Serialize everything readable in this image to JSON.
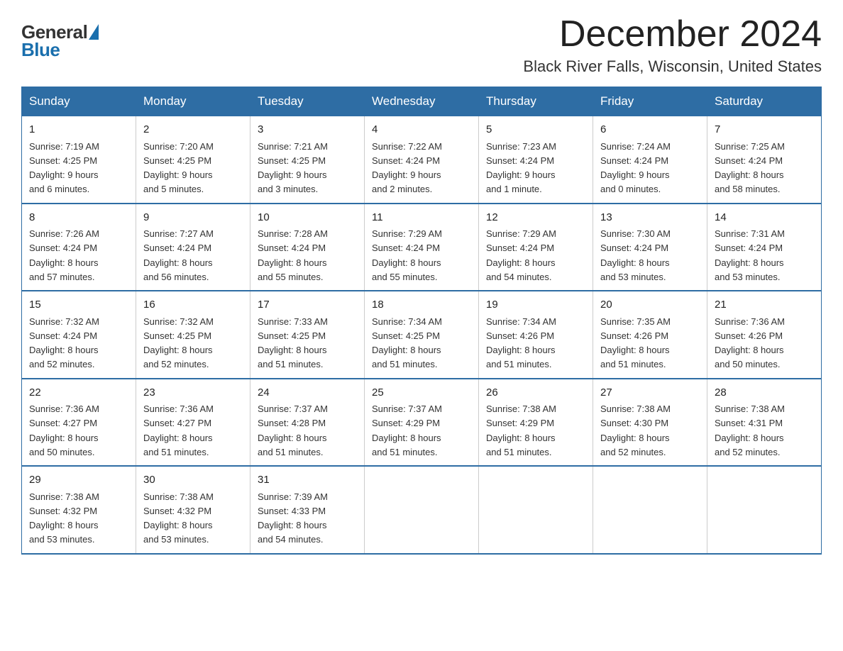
{
  "header": {
    "logo": {
      "general": "General",
      "blue": "Blue",
      "triangle": true
    },
    "title": "December 2024",
    "location": "Black River Falls, Wisconsin, United States"
  },
  "weekdays": [
    "Sunday",
    "Monday",
    "Tuesday",
    "Wednesday",
    "Thursday",
    "Friday",
    "Saturday"
  ],
  "weeks": [
    [
      {
        "day": "1",
        "sunrise": "7:19 AM",
        "sunset": "4:25 PM",
        "daylight": "9 hours and 6 minutes."
      },
      {
        "day": "2",
        "sunrise": "7:20 AM",
        "sunset": "4:25 PM",
        "daylight": "9 hours and 5 minutes."
      },
      {
        "day": "3",
        "sunrise": "7:21 AM",
        "sunset": "4:25 PM",
        "daylight": "9 hours and 3 minutes."
      },
      {
        "day": "4",
        "sunrise": "7:22 AM",
        "sunset": "4:24 PM",
        "daylight": "9 hours and 2 minutes."
      },
      {
        "day": "5",
        "sunrise": "7:23 AM",
        "sunset": "4:24 PM",
        "daylight": "9 hours and 1 minute."
      },
      {
        "day": "6",
        "sunrise": "7:24 AM",
        "sunset": "4:24 PM",
        "daylight": "9 hours and 0 minutes."
      },
      {
        "day": "7",
        "sunrise": "7:25 AM",
        "sunset": "4:24 PM",
        "daylight": "8 hours and 58 minutes."
      }
    ],
    [
      {
        "day": "8",
        "sunrise": "7:26 AM",
        "sunset": "4:24 PM",
        "daylight": "8 hours and 57 minutes."
      },
      {
        "day": "9",
        "sunrise": "7:27 AM",
        "sunset": "4:24 PM",
        "daylight": "8 hours and 56 minutes."
      },
      {
        "day": "10",
        "sunrise": "7:28 AM",
        "sunset": "4:24 PM",
        "daylight": "8 hours and 55 minutes."
      },
      {
        "day": "11",
        "sunrise": "7:29 AM",
        "sunset": "4:24 PM",
        "daylight": "8 hours and 55 minutes."
      },
      {
        "day": "12",
        "sunrise": "7:29 AM",
        "sunset": "4:24 PM",
        "daylight": "8 hours and 54 minutes."
      },
      {
        "day": "13",
        "sunrise": "7:30 AM",
        "sunset": "4:24 PM",
        "daylight": "8 hours and 53 minutes."
      },
      {
        "day": "14",
        "sunrise": "7:31 AM",
        "sunset": "4:24 PM",
        "daylight": "8 hours and 53 minutes."
      }
    ],
    [
      {
        "day": "15",
        "sunrise": "7:32 AM",
        "sunset": "4:24 PM",
        "daylight": "8 hours and 52 minutes."
      },
      {
        "day": "16",
        "sunrise": "7:32 AM",
        "sunset": "4:25 PM",
        "daylight": "8 hours and 52 minutes."
      },
      {
        "day": "17",
        "sunrise": "7:33 AM",
        "sunset": "4:25 PM",
        "daylight": "8 hours and 51 minutes."
      },
      {
        "day": "18",
        "sunrise": "7:34 AM",
        "sunset": "4:25 PM",
        "daylight": "8 hours and 51 minutes."
      },
      {
        "day": "19",
        "sunrise": "7:34 AM",
        "sunset": "4:26 PM",
        "daylight": "8 hours and 51 minutes."
      },
      {
        "day": "20",
        "sunrise": "7:35 AM",
        "sunset": "4:26 PM",
        "daylight": "8 hours and 51 minutes."
      },
      {
        "day": "21",
        "sunrise": "7:36 AM",
        "sunset": "4:26 PM",
        "daylight": "8 hours and 50 minutes."
      }
    ],
    [
      {
        "day": "22",
        "sunrise": "7:36 AM",
        "sunset": "4:27 PM",
        "daylight": "8 hours and 50 minutes."
      },
      {
        "day": "23",
        "sunrise": "7:36 AM",
        "sunset": "4:27 PM",
        "daylight": "8 hours and 51 minutes."
      },
      {
        "day": "24",
        "sunrise": "7:37 AM",
        "sunset": "4:28 PM",
        "daylight": "8 hours and 51 minutes."
      },
      {
        "day": "25",
        "sunrise": "7:37 AM",
        "sunset": "4:29 PM",
        "daylight": "8 hours and 51 minutes."
      },
      {
        "day": "26",
        "sunrise": "7:38 AM",
        "sunset": "4:29 PM",
        "daylight": "8 hours and 51 minutes."
      },
      {
        "day": "27",
        "sunrise": "7:38 AM",
        "sunset": "4:30 PM",
        "daylight": "8 hours and 52 minutes."
      },
      {
        "day": "28",
        "sunrise": "7:38 AM",
        "sunset": "4:31 PM",
        "daylight": "8 hours and 52 minutes."
      }
    ],
    [
      {
        "day": "29",
        "sunrise": "7:38 AM",
        "sunset": "4:32 PM",
        "daylight": "8 hours and 53 minutes."
      },
      {
        "day": "30",
        "sunrise": "7:38 AM",
        "sunset": "4:32 PM",
        "daylight": "8 hours and 53 minutes."
      },
      {
        "day": "31",
        "sunrise": "7:39 AM",
        "sunset": "4:33 PM",
        "daylight": "8 hours and 54 minutes."
      },
      null,
      null,
      null,
      null
    ]
  ],
  "labels": {
    "sunrise": "Sunrise:",
    "sunset": "Sunset:",
    "daylight": "Daylight:"
  }
}
